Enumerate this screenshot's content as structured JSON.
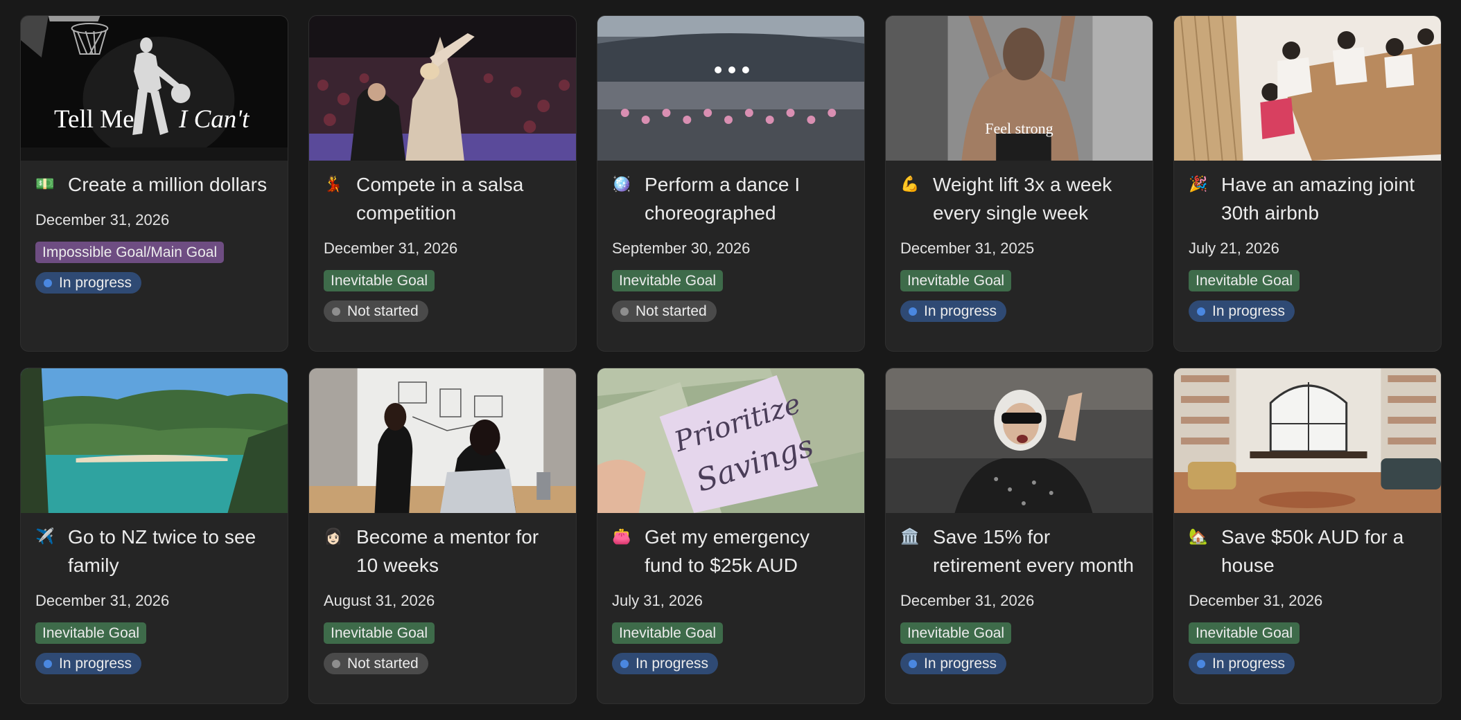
{
  "cards": [
    {
      "icon": "money-icon",
      "emoji": "💵",
      "title": "Create a million dollars",
      "date": "December 31, 2026",
      "tag": "Impossible Goal/Main Goal",
      "tag_kind": "impossible",
      "status": "In progress",
      "status_kind": "inprogress",
      "cover": "jordan",
      "cover_text_left": "Tell Me",
      "cover_text_right": "I Can't"
    },
    {
      "icon": "salsa-dancer-icon",
      "emoji": "💃",
      "title": "Compete in a salsa competition",
      "date": "December 31, 2026",
      "tag": "Inevitable Goal",
      "tag_kind": "inevitable",
      "status": "Not started",
      "status_kind": "notstarted",
      "cover": "salsa"
    },
    {
      "icon": "disco-ball-icon",
      "emoji": "🪩",
      "title": "Perform a dance I choreographed",
      "date": "September 30, 2026",
      "tag": "Inevitable Goal",
      "tag_kind": "inevitable",
      "status": "Not started",
      "status_kind": "notstarted",
      "cover": "stadium"
    },
    {
      "icon": "muscle-icon",
      "emoji": "💪",
      "title": "Weight lift 3x a week every single week",
      "date": "December 31, 2025",
      "tag": "Inevitable Goal",
      "tag_kind": "inevitable",
      "status": "In progress",
      "status_kind": "inprogress",
      "cover": "gym",
      "cover_text": "Feel strong"
    },
    {
      "icon": "party-popper-icon",
      "emoji": "🎉",
      "title": "Have an amazing joint 30th airbnb",
      "date": "July 21, 2026",
      "tag": "Inevitable Goal",
      "tag_kind": "inevitable",
      "status": "In progress",
      "status_kind": "inprogress",
      "cover": "dinner"
    },
    {
      "icon": "airplane-icon",
      "emoji": "✈️",
      "title": "Go to NZ twice to see family",
      "date": "December 31, 2026",
      "tag": "Inevitable Goal",
      "tag_kind": "inevitable",
      "status": "In progress",
      "status_kind": "inprogress",
      "cover": "nz"
    },
    {
      "icon": "person-icon",
      "emoji": "👩🏻",
      "title": "Become a mentor for 10 weeks",
      "date": "August 31, 2026",
      "tag": "Inevitable Goal",
      "tag_kind": "inevitable",
      "status": "Not started",
      "status_kind": "notstarted",
      "cover": "mentor"
    },
    {
      "icon": "purse-icon",
      "emoji": "👛",
      "title": "Get my emergency fund to $25k AUD",
      "date": "July 31, 2026",
      "tag": "Inevitable Goal",
      "tag_kind": "inevitable",
      "status": "In progress",
      "status_kind": "inprogress",
      "cover": "savings",
      "cover_text_1": "Prioritize",
      "cover_text_2": "Savings"
    },
    {
      "icon": "bank-icon",
      "emoji": "🏛️",
      "title": "Save 15% for retirement every month",
      "date": "December 31, 2026",
      "tag": "Inevitable Goal",
      "tag_kind": "inevitable",
      "status": "In progress",
      "status_kind": "inprogress",
      "cover": "granny"
    },
    {
      "icon": "house-icon",
      "emoji": "🏡",
      "title": "Save $50k AUD for a house",
      "date": "December 31, 2026",
      "tag": "Inevitable Goal",
      "tag_kind": "inevitable",
      "status": "In progress",
      "status_kind": "inprogress",
      "cover": "livingroom"
    }
  ]
}
